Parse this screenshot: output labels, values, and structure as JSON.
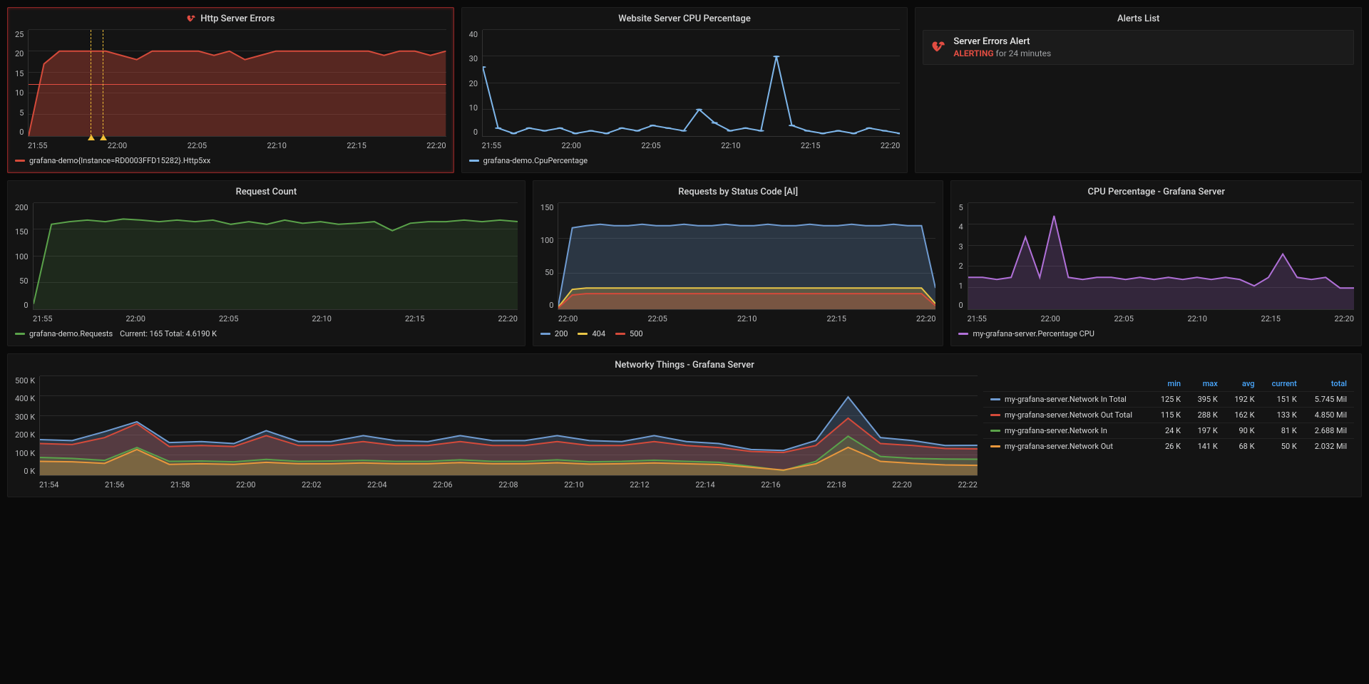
{
  "panels": {
    "http_errors": {
      "title": "Http Server Errors",
      "legend": "grafana-demo{Instance=RD0003FFD15282}.Http5xx"
    },
    "cpu_pct": {
      "title": "Website Server CPU Percentage",
      "legend": "grafana-demo.CpuPercentage"
    },
    "alerts": {
      "title": "Alerts List"
    },
    "req_count": {
      "title": "Request Count",
      "legend": "grafana-demo.Requests",
      "legend_stats": "Current: 165  Total: 4.6190 K"
    },
    "req_status": {
      "title": "Requests by Status Code [AI]"
    },
    "cpu_grafana": {
      "title": "CPU Percentage - Grafana Server",
      "legend": "my-grafana-server.Percentage CPU"
    },
    "network": {
      "title": "Networky Things - Grafana Server"
    }
  },
  "alert_item": {
    "title": "Server Errors Alert",
    "state": "ALERTING",
    "duration": "for 24 minutes"
  },
  "status_legend": {
    "s200": "200",
    "s404": "404",
    "s500": "500"
  },
  "network_table": {
    "headers": {
      "min": "min",
      "max": "max",
      "avg": "avg",
      "current": "current",
      "total": "total"
    },
    "rows": [
      {
        "name": "my-grafana-server.Network In Total",
        "color": "#6f9bd1",
        "min": "125 K",
        "max": "395 K",
        "avg": "192 K",
        "current": "151 K",
        "total": "5.745 Mil"
      },
      {
        "name": "my-grafana-server.Network Out Total",
        "color": "#d44a3a",
        "min": "115 K",
        "max": "288 K",
        "avg": "162 K",
        "current": "133 K",
        "total": "4.850 Mil"
      },
      {
        "name": "my-grafana-server.Network In",
        "color": "#5aa24a",
        "min": "24 K",
        "max": "197 K",
        "avg": "90 K",
        "current": "81 K",
        "total": "2.688 Mil"
      },
      {
        "name": "my-grafana-server.Network Out",
        "color": "#e8973c",
        "min": "26 K",
        "max": "141 K",
        "avg": "68 K",
        "current": "50 K",
        "total": "2.032 Mil"
      }
    ]
  },
  "chart_data": [
    {
      "id": "http_errors",
      "type": "area",
      "fill": 0.35,
      "color": "#d44a3a",
      "threshold": 12,
      "ylim": [
        0,
        25
      ],
      "yticks": [
        0,
        5,
        10,
        15,
        20,
        25
      ],
      "xticks": [
        "21:55",
        "22:00",
        "22:05",
        "22:10",
        "22:15",
        "22:20"
      ],
      "x": [
        0,
        1,
        2,
        3,
        4,
        5,
        6,
        7,
        8,
        9,
        10,
        11,
        12,
        13,
        14,
        15,
        16,
        17,
        18,
        19,
        20,
        21,
        22,
        23,
        24,
        25,
        26,
        27
      ],
      "series": [
        {
          "name": "Http5xx",
          "values": [
            0,
            17,
            20,
            20,
            20,
            20,
            19,
            18,
            20,
            20,
            20,
            20,
            19,
            20,
            18,
            19,
            20,
            20,
            20,
            20,
            20,
            20,
            20,
            19,
            20,
            20,
            19,
            20
          ]
        }
      ],
      "annotations_x": [
        4.0,
        4.8
      ]
    },
    {
      "id": "cpu_pct",
      "type": "line",
      "markers": true,
      "fill": 0.1,
      "color": "#7eb6ea",
      "ylim": [
        0,
        40
      ],
      "yticks": [
        0,
        10,
        20,
        30,
        40
      ],
      "xticks": [
        "21:55",
        "22:00",
        "22:05",
        "22:10",
        "22:15",
        "22:20"
      ],
      "x": [
        0,
        1,
        2,
        3,
        4,
        5,
        6,
        7,
        8,
        9,
        10,
        11,
        12,
        13,
        14,
        15,
        16,
        17,
        18,
        19,
        20,
        21,
        22,
        23,
        24,
        25,
        26,
        27
      ],
      "series": [
        {
          "name": "CpuPercentage",
          "values": [
            26,
            3,
            1,
            3,
            2,
            3,
            1,
            2,
            1,
            3,
            2,
            4,
            3,
            2,
            10,
            5,
            2,
            3,
            2,
            30,
            4,
            2,
            1,
            2,
            1,
            3,
            2,
            1
          ]
        }
      ]
    },
    {
      "id": "req_count",
      "type": "area",
      "fill": 0.15,
      "color": "#5aa24a",
      "ylim": [
        0,
        200
      ],
      "yticks": [
        0,
        50,
        100,
        150,
        200
      ],
      "xticks": [
        "21:55",
        "22:00",
        "22:05",
        "22:10",
        "22:15",
        "22:20"
      ],
      "x": [
        0,
        1,
        2,
        3,
        4,
        5,
        6,
        7,
        8,
        9,
        10,
        11,
        12,
        13,
        14,
        15,
        16,
        17,
        18,
        19,
        20,
        21,
        22,
        23,
        24,
        25,
        26,
        27
      ],
      "series": [
        {
          "name": "Requests",
          "values": [
            10,
            160,
            165,
            168,
            165,
            170,
            168,
            165,
            168,
            165,
            168,
            160,
            165,
            160,
            168,
            162,
            165,
            160,
            162,
            165,
            148,
            162,
            165,
            165,
            168,
            165,
            168,
            165
          ]
        }
      ]
    },
    {
      "id": "req_status",
      "type": "area-stack",
      "fill": 0.25,
      "ylim": [
        0,
        150
      ],
      "yticks": [
        0,
        50,
        100,
        150
      ],
      "xticks": [
        "22:00",
        "22:05",
        "22:10",
        "22:15",
        "22:20"
      ],
      "x": [
        0,
        1,
        2,
        3,
        4,
        5,
        6,
        7,
        8,
        9,
        10,
        11,
        12,
        13,
        14,
        15,
        16,
        17,
        18,
        19,
        20,
        21,
        22,
        23,
        24,
        25,
        26,
        27
      ],
      "series": [
        {
          "name": "200",
          "color": "#6f9bd1",
          "values": [
            5,
            115,
            118,
            120,
            118,
            118,
            120,
            118,
            118,
            120,
            118,
            118,
            120,
            118,
            118,
            120,
            118,
            118,
            120,
            118,
            118,
            120,
            118,
            118,
            120,
            118,
            118,
            30
          ]
        },
        {
          "name": "404",
          "color": "#e8c547",
          "values": [
            3,
            28,
            30,
            30,
            30,
            30,
            30,
            30,
            30,
            30,
            30,
            30,
            30,
            30,
            30,
            30,
            30,
            30,
            30,
            30,
            30,
            30,
            30,
            30,
            30,
            30,
            30,
            8
          ]
        },
        {
          "name": "500",
          "color": "#d44a3a",
          "values": [
            2,
            20,
            22,
            22,
            22,
            22,
            22,
            22,
            22,
            22,
            22,
            22,
            22,
            22,
            22,
            22,
            22,
            22,
            22,
            22,
            22,
            22,
            22,
            22,
            22,
            22,
            22,
            5
          ]
        }
      ]
    },
    {
      "id": "cpu_grafana",
      "type": "area",
      "fill": 0.2,
      "color": "#b070d8",
      "ylim": [
        0,
        5
      ],
      "yticks": [
        0,
        1,
        2,
        3,
        4,
        5
      ],
      "xticks": [
        "21:55",
        "22:00",
        "22:05",
        "22:10",
        "22:15",
        "22:20"
      ],
      "x": [
        0,
        1,
        2,
        3,
        4,
        5,
        6,
        7,
        8,
        9,
        10,
        11,
        12,
        13,
        14,
        15,
        16,
        17,
        18,
        19,
        20,
        21,
        22,
        23,
        24,
        25,
        26,
        27
      ],
      "series": [
        {
          "name": "Percentage CPU",
          "values": [
            1.5,
            1.5,
            1.4,
            1.5,
            3.4,
            1.5,
            4.4,
            1.5,
            1.4,
            1.5,
            1.5,
            1.4,
            1.5,
            1.4,
            1.5,
            1.4,
            1.5,
            1.4,
            1.5,
            1.4,
            1.1,
            1.5,
            2.6,
            1.5,
            1.4,
            1.5,
            1.0,
            1.0
          ]
        }
      ]
    },
    {
      "id": "network",
      "type": "area-overlay",
      "fill": 0.25,
      "ylim": [
        0,
        500
      ],
      "yticks": [
        0,
        100,
        200,
        300,
        400,
        500
      ],
      "ysuffix": " K",
      "xticks": [
        "21:54",
        "21:56",
        "21:58",
        "22:00",
        "22:02",
        "22:04",
        "22:06",
        "22:08",
        "22:10",
        "22:12",
        "22:14",
        "22:16",
        "22:18",
        "22:20",
        "22:22"
      ],
      "x": [
        0,
        1,
        2,
        3,
        4,
        5,
        6,
        7,
        8,
        9,
        10,
        11,
        12,
        13,
        14,
        15,
        16,
        17,
        18,
        19,
        20,
        21,
        22,
        23,
        24,
        25,
        26,
        27,
        28,
        29
      ],
      "series": [
        {
          "name": "Network In Total",
          "color": "#6f9bd1",
          "values": [
            180,
            175,
            220,
            270,
            165,
            170,
            160,
            225,
            170,
            170,
            200,
            175,
            170,
            200,
            175,
            175,
            200,
            175,
            170,
            200,
            170,
            160,
            130,
            125,
            175,
            395,
            190,
            175,
            150,
            151
          ]
        },
        {
          "name": "Network Out Total",
          "color": "#d44a3a",
          "values": [
            160,
            155,
            190,
            260,
            145,
            150,
            145,
            200,
            150,
            150,
            170,
            150,
            150,
            170,
            150,
            150,
            170,
            150,
            150,
            170,
            150,
            140,
            120,
            115,
            150,
            288,
            160,
            150,
            135,
            133
          ]
        },
        {
          "name": "Network In",
          "color": "#5aa24a",
          "values": [
            90,
            85,
            75,
            140,
            70,
            72,
            68,
            80,
            70,
            72,
            75,
            70,
            70,
            78,
            70,
            70,
            78,
            68,
            70,
            76,
            70,
            65,
            45,
            24,
            70,
            197,
            95,
            85,
            82,
            81
          ]
        },
        {
          "name": "Network Out",
          "color": "#e8973c",
          "values": [
            70,
            68,
            60,
            130,
            55,
            58,
            55,
            65,
            58,
            58,
            62,
            58,
            58,
            64,
            58,
            58,
            63,
            56,
            58,
            62,
            58,
            54,
            40,
            26,
            58,
            141,
            70,
            60,
            52,
            50
          ]
        }
      ]
    }
  ]
}
